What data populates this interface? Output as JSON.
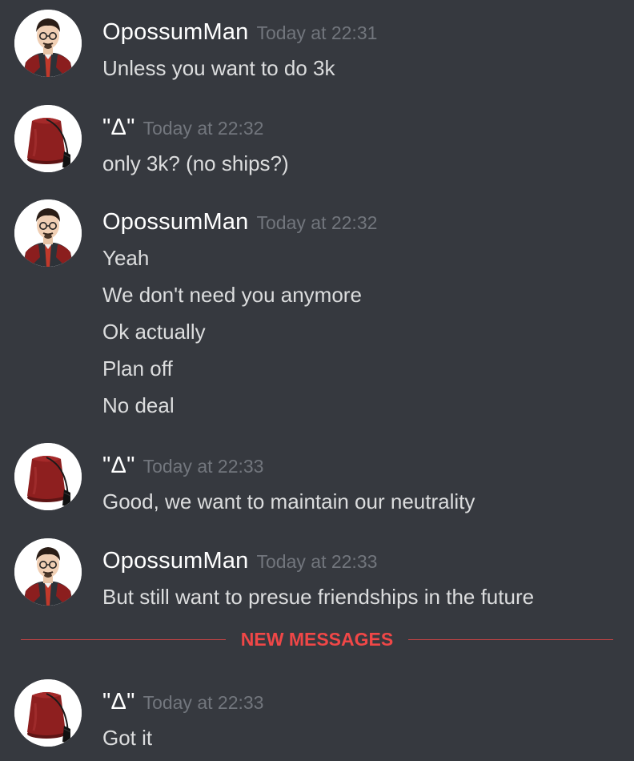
{
  "messages": [
    {
      "author": "OpossumMan",
      "avatar": "opossumman-avatar",
      "timestamp": "Today at 22:31",
      "lines": [
        "Unless you want to do 3k"
      ]
    },
    {
      "author": "\"Δ\"",
      "avatar": "fez-avatar",
      "timestamp": "Today at 22:32",
      "lines": [
        "only 3k? (no ships?)"
      ]
    },
    {
      "author": "OpossumMan",
      "avatar": "opossumman-avatar",
      "timestamp": "Today at 22:32",
      "lines": [
        "Yeah",
        "We don't need you anymore",
        "Ok actually",
        "Plan off",
        "No deal"
      ]
    },
    {
      "author": "\"Δ\"",
      "avatar": "fez-avatar",
      "timestamp": "Today at 22:33",
      "lines": [
        "Good, we want to maintain our neutrality"
      ]
    },
    {
      "author": "OpossumMan",
      "avatar": "opossumman-avatar",
      "timestamp": "Today at 22:33",
      "lines": [
        "But still want to presue friendships in the future"
      ]
    },
    {
      "author": "\"Δ\"",
      "avatar": "fez-avatar",
      "timestamp": "Today at 22:33",
      "lines": [
        "Got it"
      ]
    }
  ],
  "divider": {
    "label": "NEW MESSAGES",
    "color": "#f04747"
  },
  "colors": {
    "background": "#36393f",
    "username": "#ffffff",
    "timestamp": "#72767d",
    "message_text": "#dcddde"
  }
}
